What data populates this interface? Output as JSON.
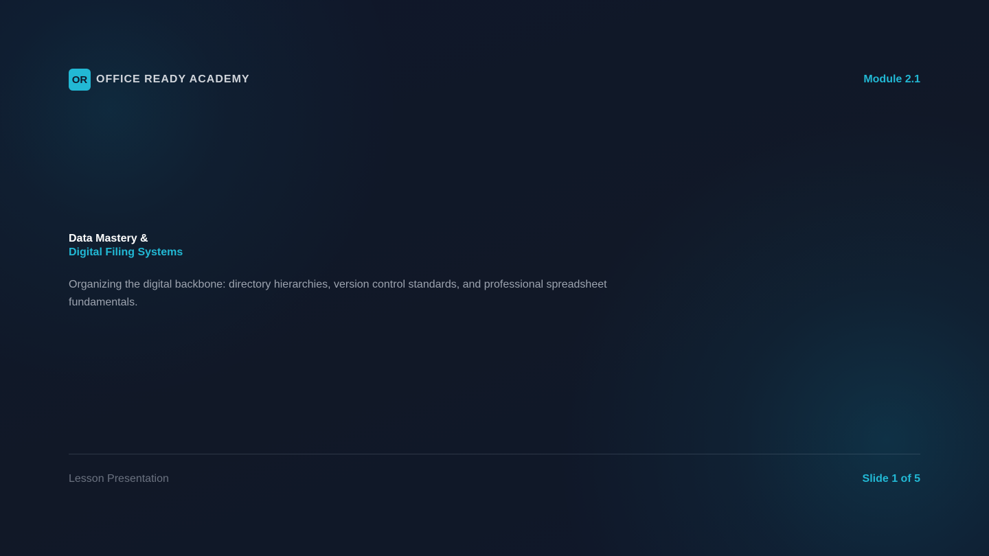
{
  "header": {
    "logo_text": "OR",
    "brand_name": "OFFICE READY ACADEMY",
    "module": "Module 2.1"
  },
  "title": {
    "line1": "Data Mastery &",
    "line2": "Digital Filing Systems"
  },
  "description": "Organizing the digital backbone: directory hierarchies, version control standards, and professional spreadsheet fundamentals.",
  "footer": {
    "left": "Lesson Presentation",
    "right": "Slide 1 of 5"
  },
  "colors": {
    "accent": "#22b8d4",
    "background": "#111827",
    "title": "#ffffff",
    "body_text": "#9ca3af",
    "muted_text": "#6b7280"
  }
}
